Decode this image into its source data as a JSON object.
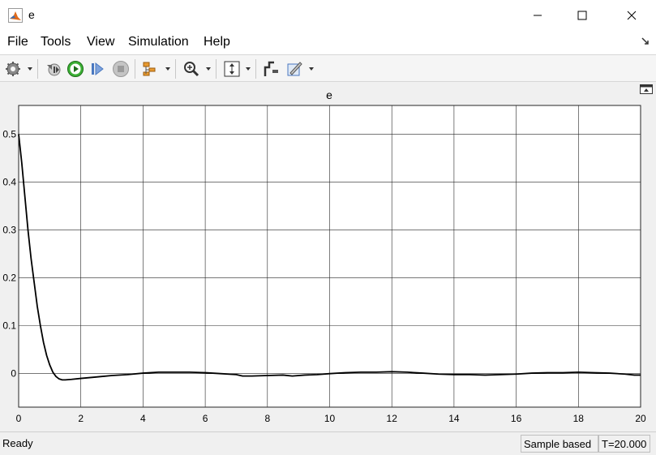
{
  "window": {
    "title": "e"
  },
  "menu": [
    "File",
    "Tools",
    "View",
    "Simulation",
    "Help"
  ],
  "toolbar_icons": [
    "gear-icon",
    "step-back-icon",
    "run-icon",
    "step-forward-icon",
    "stop-icon",
    "signal-tree-icon",
    "zoom-in-icon",
    "fit-to-view-icon",
    "cursor-measure-icon",
    "style-icon"
  ],
  "status": {
    "ready": "Ready",
    "mode": "Sample based",
    "time": "T=20.000"
  },
  "colors": {
    "line": "#000000",
    "axes_bg": "#ffffff",
    "figure_bg": "#f0f0f0",
    "grid": "#262626"
  },
  "chart_data": {
    "type": "line",
    "title": "e",
    "xlabel": "",
    "ylabel": "",
    "xlim": [
      0,
      20
    ],
    "ylim": [
      -0.07,
      0.56
    ],
    "xticks": [
      0,
      2,
      4,
      6,
      8,
      10,
      12,
      14,
      16,
      18,
      20
    ],
    "yticks": [
      0,
      0.1,
      0.2,
      0.3,
      0.4,
      0.5
    ],
    "xtick_labels": [
      "0",
      "2",
      "4",
      "6",
      "8",
      "10",
      "12",
      "14",
      "16",
      "18",
      "20"
    ],
    "ytick_labels": [
      "0",
      "0.1",
      "0.2",
      "0.3",
      "0.4",
      "0.5"
    ],
    "grid": true,
    "series": [
      {
        "x": [
          0,
          0.1,
          0.2,
          0.3,
          0.4,
          0.5,
          0.6,
          0.7,
          0.8,
          0.9,
          1.0,
          1.1,
          1.2,
          1.3,
          1.4,
          1.5,
          1.7,
          2.0,
          2.5,
          3.0,
          3.5,
          4.0,
          4.5,
          5.0,
          5.5,
          6.0,
          6.5,
          7.0,
          7.2,
          7.5,
          8.0,
          8.5,
          8.8,
          9.2,
          9.6,
          10.0,
          10.5,
          11.0,
          11.5,
          12.0,
          12.5,
          13.0,
          13.5,
          14.0,
          14.5,
          15.0,
          15.5,
          16.0,
          16.5,
          17.0,
          17.5,
          18.0,
          18.5,
          19.0,
          19.5,
          19.8,
          20.0
        ],
        "y": [
          0.5,
          0.44,
          0.37,
          0.3,
          0.24,
          0.19,
          0.14,
          0.1,
          0.065,
          0.038,
          0.018,
          0.003,
          -0.006,
          -0.011,
          -0.013,
          -0.013,
          -0.012,
          -0.01,
          -0.007,
          -0.004,
          -0.002,
          0.001,
          0.003,
          0.003,
          0.003,
          0.002,
          0.0,
          -0.002,
          -0.005,
          -0.005,
          -0.004,
          -0.003,
          -0.005,
          -0.003,
          -0.002,
          0.0,
          0.002,
          0.003,
          0.003,
          0.004,
          0.003,
          0.001,
          -0.001,
          -0.002,
          -0.002,
          -0.003,
          -0.002,
          -0.001,
          0.001,
          0.002,
          0.002,
          0.003,
          0.002,
          0.001,
          -0.001,
          -0.003,
          -0.003
        ]
      }
    ]
  }
}
